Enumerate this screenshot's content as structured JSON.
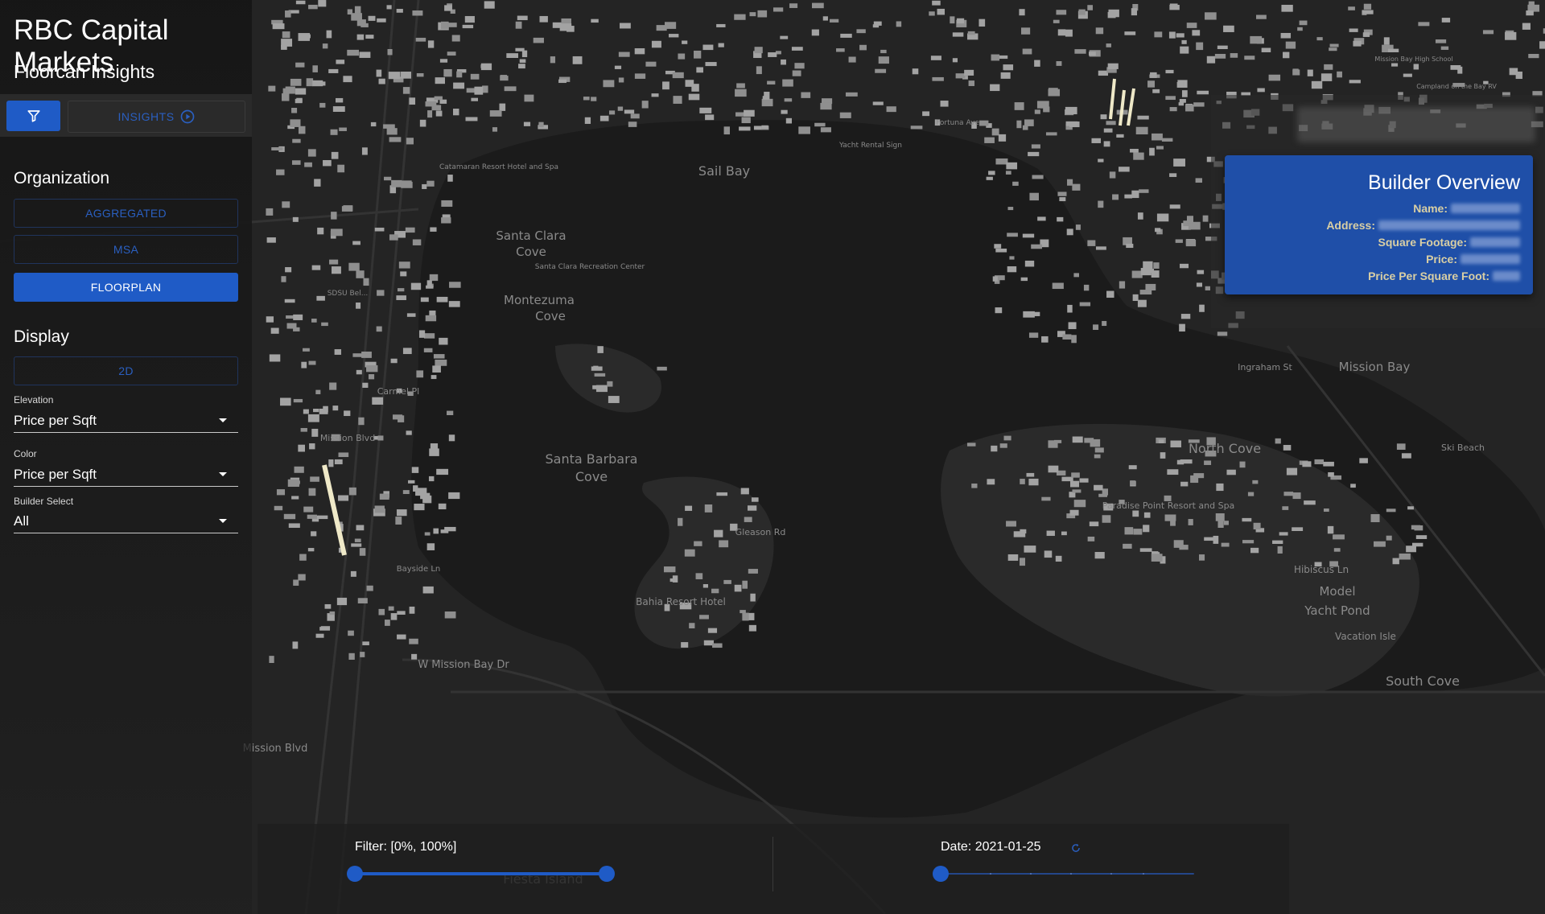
{
  "app": {
    "title": "RBC Capital Markets",
    "subtitle": "Floorcan Insights"
  },
  "toolbar": {
    "filter_icon": "filter-icon",
    "insights_label": "INSIGHTS",
    "insights_icon": "play-circle-icon"
  },
  "organization": {
    "title": "Organization",
    "options": [
      {
        "label": "AGGREGATED",
        "active": false
      },
      {
        "label": "MSA",
        "active": false
      },
      {
        "label": "FLOORPLAN",
        "active": true
      }
    ]
  },
  "display": {
    "title": "Display",
    "mode_label": "2D",
    "elevation": {
      "label": "Elevation",
      "value": "Price per Sqft"
    },
    "color": {
      "label": "Color",
      "value": "Price per Sqft"
    },
    "builder_select": {
      "label": "Builder Select",
      "value": "All"
    }
  },
  "builder_overview": {
    "title": "Builder Overview",
    "fields": [
      {
        "label": "Name:"
      },
      {
        "label": "Address:"
      },
      {
        "label": "Square Footage:"
      },
      {
        "label": "Price:"
      },
      {
        "label": "Price Per Square Foot:"
      }
    ]
  },
  "bottom": {
    "filter_label": "Filter: [0%, 100%]",
    "filter_range": [
      0,
      100
    ],
    "date_label": "Date: 2021-01-25",
    "date_position": 0
  },
  "map": {
    "labels": [
      "Sail Bay",
      "Santa Clara",
      "Cove",
      "Montezuma",
      "Cove",
      "Santa Barbara",
      "Cove",
      "North Cove",
      "Mission Bay",
      "Model",
      "Yacht Pond",
      "South Cove",
      "Vacation Isle",
      "Hibiscus Ln",
      "Ski Beach",
      "Bahia Resort Hotel",
      "W Mission Bay Dr",
      "Mission Blvd",
      "Mission Blvd",
      "Carmel Pl",
      "Gleason Rd",
      "Ingraham St",
      "Paradise Point Resort and Spa",
      "Santa Clara Recreation Center",
      "Catamaran Resort Hotel and Spa",
      "Mission Bay High School",
      "Campland on the Bay RV",
      "Fiesta Island",
      "SDSU Bel...",
      "Bayside Ln",
      "Yacht Rental Sign",
      "Fortuna Ave"
    ],
    "colors": {
      "land": "#242424",
      "water": "#1b1b1b",
      "buildings": "#9a9a9a",
      "roads": "#2f2f2f",
      "accent": "#1f5bc6",
      "highlight": "#efe9c8"
    }
  }
}
